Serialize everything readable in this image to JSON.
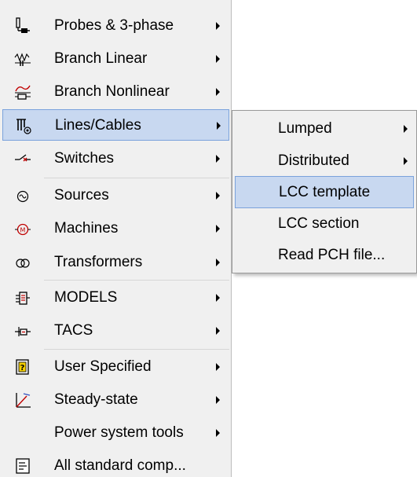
{
  "main_menu": {
    "items": [
      {
        "label": "Probes & 3-phase",
        "icon": "probe-icon",
        "has_submenu": true
      },
      {
        "label": "Branch Linear",
        "icon": "branch-linear-icon",
        "has_submenu": true
      },
      {
        "label": "Branch Nonlinear",
        "icon": "branch-nonlinear-icon",
        "has_submenu": true
      },
      {
        "label": "Lines/Cables",
        "icon": "lines-cables-icon",
        "has_submenu": true,
        "highlighted": true
      },
      {
        "label": "Switches",
        "icon": "switch-icon",
        "has_submenu": true
      },
      {
        "label": "Sources",
        "icon": "source-icon",
        "has_submenu": true
      },
      {
        "label": "Machines",
        "icon": "machine-icon",
        "has_submenu": true
      },
      {
        "label": "Transformers",
        "icon": "transformer-icon",
        "has_submenu": true
      },
      {
        "label": "MODELS",
        "icon": "models-icon",
        "has_submenu": true
      },
      {
        "label": "TACS",
        "icon": "tacs-icon",
        "has_submenu": true
      },
      {
        "label": "User Specified",
        "icon": "user-specified-icon",
        "has_submenu": true
      },
      {
        "label": "Steady-state",
        "icon": "steady-state-icon",
        "has_submenu": true
      },
      {
        "label": "Power system tools",
        "icon": "",
        "has_submenu": true
      },
      {
        "label": "All standard comp...",
        "icon": "all-components-icon",
        "has_submenu": false
      }
    ]
  },
  "submenu": {
    "items": [
      {
        "label": "Lumped",
        "has_submenu": true
      },
      {
        "label": "Distributed",
        "has_submenu": true
      },
      {
        "label": "LCC template",
        "has_submenu": false,
        "highlighted": true
      },
      {
        "label": "LCC section",
        "has_submenu": false
      },
      {
        "label": "Read PCH file...",
        "has_submenu": false
      }
    ]
  },
  "colors": {
    "menu_background": "#f0f0f0",
    "highlight_fill": "#c8d8f0",
    "highlight_border": "#7aa2dc"
  }
}
